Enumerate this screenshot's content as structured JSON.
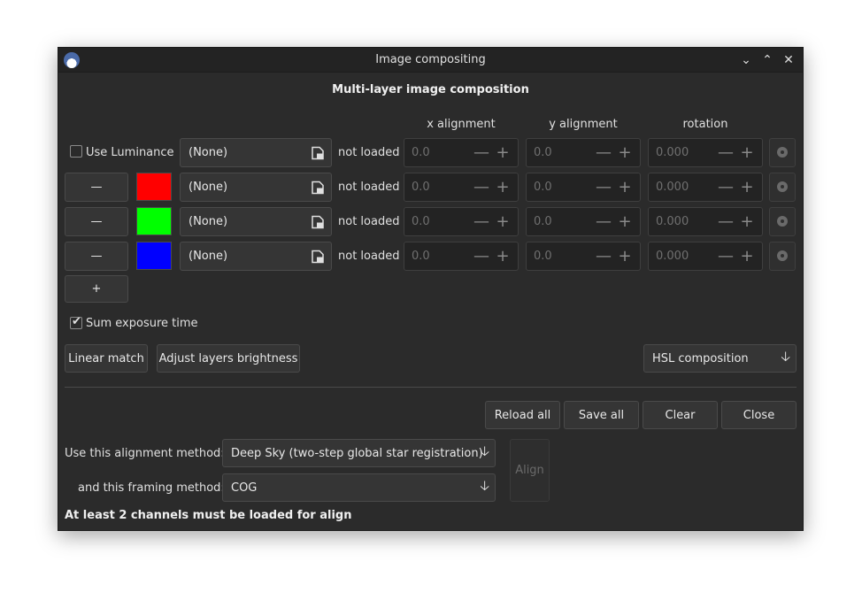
{
  "window": {
    "title": "Image compositing",
    "controls": {
      "minimize": "⌄",
      "maximize": "⌃",
      "close": "✕"
    }
  },
  "heading": "Multi-layer image composition",
  "columns": {
    "x": "x alignment",
    "y": "y alignment",
    "rot": "rotation"
  },
  "use_luminance": {
    "label": "Use Luminance",
    "checked": false
  },
  "layers": [
    {
      "color": "",
      "file": "(None)",
      "status": "not loaded",
      "x": "0.0",
      "y": "0.0",
      "rot": "0.000"
    },
    {
      "color": "#ff0000",
      "file": "(None)",
      "status": "not loaded",
      "x": "0.0",
      "y": "0.0",
      "rot": "0.000"
    },
    {
      "color": "#00ff00",
      "file": "(None)",
      "status": "not loaded",
      "x": "0.0",
      "y": "0.0",
      "rot": "0.000"
    },
    {
      "color": "#0000ff",
      "file": "(None)",
      "status": "not loaded",
      "x": "0.0",
      "y": "0.0",
      "rot": "0.000"
    }
  ],
  "remove_label": "—",
  "add_label": "+",
  "spin": {
    "minus": "—",
    "plus": "+"
  },
  "sum_exposure": {
    "label": "Sum exposure time",
    "checked": true
  },
  "buttons": {
    "linear_match": "Linear match",
    "adjust_brightness": "Adjust layers brightness",
    "composition": "HSL composition",
    "reload_all": "Reload all",
    "save_all": "Save all",
    "clear": "Clear",
    "close": "Close",
    "align": "Align"
  },
  "alignment": {
    "method_label": "Use this alignment method:",
    "method_value": "Deep Sky (two-step global star registration)",
    "framing_label": "and this framing method:",
    "framing_value": "COG"
  },
  "warning": "At least 2 channels must be loaded for align",
  "icons": {
    "dropdown": "down-arrow-icon",
    "file": "file-open-icon"
  }
}
